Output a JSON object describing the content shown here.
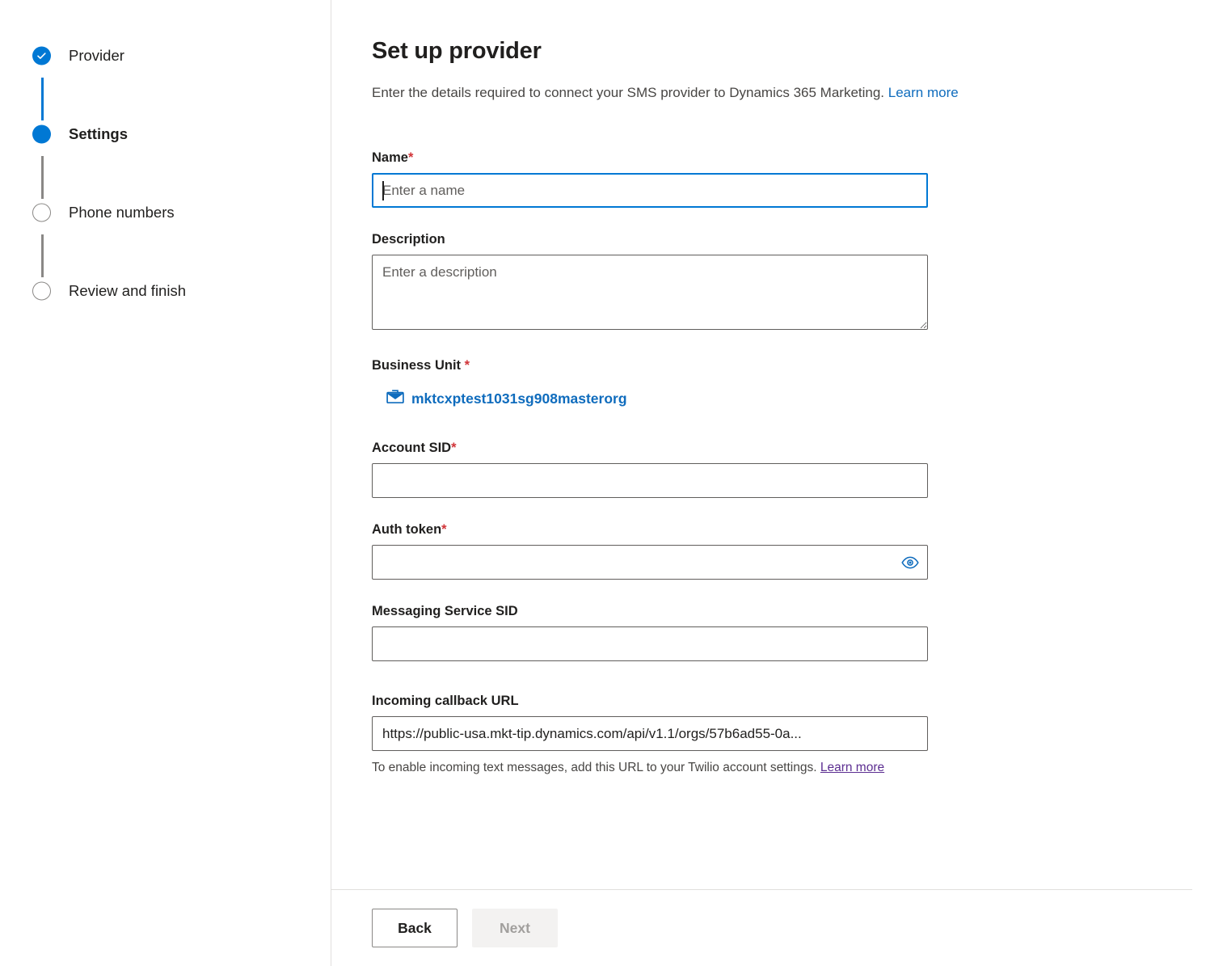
{
  "stepper": {
    "steps": [
      {
        "label": "Provider",
        "state": "done",
        "icon": "check-icon"
      },
      {
        "label": "Settings",
        "state": "current",
        "icon": "filled-circle-icon"
      },
      {
        "label": "Phone numbers",
        "state": "todo",
        "icon": "empty-circle-icon"
      },
      {
        "label": "Review and finish",
        "state": "todo",
        "icon": "empty-circle-icon"
      }
    ]
  },
  "header": {
    "title": "Set up provider",
    "subtitle": "Enter the details required to connect your SMS provider to Dynamics 365 Marketing.",
    "learn_more": "Learn more"
  },
  "form": {
    "name": {
      "label": "Name",
      "required_mark": "*",
      "placeholder": "Enter a name",
      "value": ""
    },
    "description": {
      "label": "Description",
      "placeholder": "Enter a description",
      "value": ""
    },
    "business_unit": {
      "label": "Business Unit ",
      "required_mark": "*",
      "icon": "briefcase-icon",
      "value": "mktcxptest1031sg908masterorg"
    },
    "account_sid": {
      "label": "Account SID",
      "required_mark": "*",
      "placeholder": "",
      "value": ""
    },
    "auth_token": {
      "label": "Auth token",
      "required_mark": "*",
      "placeholder": "",
      "value": "",
      "reveal_icon": "eye-icon"
    },
    "messaging_service_sid": {
      "label": "Messaging Service SID",
      "placeholder": "",
      "value": ""
    },
    "incoming_callback_url": {
      "label": "Incoming callback URL",
      "value": "https://public-usa.mkt-tip.dynamics.com/api/v1.1/orgs/57b6ad55-0a...",
      "hint": "To enable incoming text messages, add this URL to your Twilio account settings.",
      "hint_link": "Learn more"
    }
  },
  "footer": {
    "back_label": "Back",
    "next_label": "Next"
  },
  "colors": {
    "accent": "#0078d4",
    "link": "#0f6cbd",
    "link_visited": "#5c2e91",
    "required": "#d13438",
    "border": "#605e5c",
    "divider": "#e1dfdd",
    "disabled_bg": "#f3f2f1",
    "disabled_text": "#a19f9d"
  }
}
